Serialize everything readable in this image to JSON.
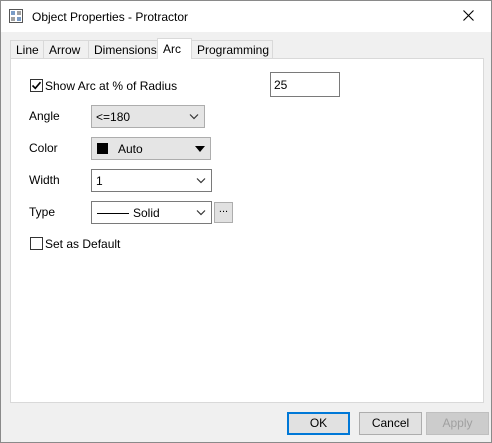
{
  "window": {
    "title": "Object Properties - Protractor"
  },
  "tabs": [
    {
      "label": "Line"
    },
    {
      "label": "Arrow"
    },
    {
      "label": "Dimensions"
    },
    {
      "label": "Arc",
      "active": true
    },
    {
      "label": "Programming"
    }
  ],
  "arc": {
    "show_arc_label": "Show Arc at % of Radius",
    "show_arc_checked": true,
    "radius_percent": "25",
    "angle_label": "Angle",
    "angle_value": "<=180",
    "color_label": "Color",
    "color_value": "Auto",
    "width_label": "Width",
    "width_value": "1",
    "type_label": "Type",
    "type_value": "Solid",
    "ellipsis": "...",
    "set_default_label": "Set as Default",
    "set_default_checked": false
  },
  "buttons": {
    "ok": "OK",
    "cancel": "Cancel",
    "apply": "Apply"
  },
  "colors": {
    "accent": "#0078d7",
    "swatch": "#000000"
  },
  "icons": {
    "app": "object-properties-icon",
    "close": "close-icon"
  }
}
